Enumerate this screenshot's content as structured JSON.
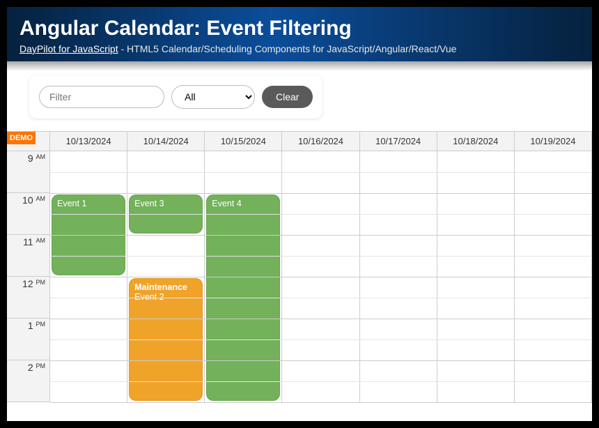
{
  "header": {
    "title": "Angular Calendar: Event Filtering",
    "link_text": "DayPilot for JavaScript",
    "subtitle_rest": " - HTML5 Calendar/Scheduling Components for JavaScript/Angular/React/Vue"
  },
  "filter": {
    "placeholder": "Filter",
    "select_value": "All",
    "clear_label": "Clear"
  },
  "calendar": {
    "demo_badge": "DEMO",
    "days": [
      "10/13/2024",
      "10/14/2024",
      "10/15/2024",
      "10/16/2024",
      "10/17/2024",
      "10/18/2024",
      "10/19/2024"
    ],
    "hours": [
      {
        "num": "9",
        "ampm": "AM"
      },
      {
        "num": "10",
        "ampm": "AM"
      },
      {
        "num": "11",
        "ampm": "AM"
      },
      {
        "num": "12",
        "ampm": "PM"
      },
      {
        "num": "1",
        "ampm": "PM"
      },
      {
        "num": "2",
        "ampm": "PM"
      }
    ],
    "events": [
      {
        "id": "event1",
        "day": 0,
        "start_hour_idx": 1,
        "end_hour_idx": 3,
        "color": "green",
        "title": "",
        "text": "Event 1"
      },
      {
        "id": "event3",
        "day": 1,
        "start_hour_idx": 1,
        "end_hour_idx": 2,
        "color": "green",
        "title": "",
        "text": "Event 3"
      },
      {
        "id": "event2",
        "day": 1,
        "start_hour_idx": 3,
        "end_hour_idx": 6,
        "color": "orange",
        "title": "Maintenance",
        "text": "Event 2"
      },
      {
        "id": "event4",
        "day": 2,
        "start_hour_idx": 1,
        "end_hour_idx": 6,
        "color": "green",
        "title": "",
        "text": "Event 4"
      }
    ]
  }
}
